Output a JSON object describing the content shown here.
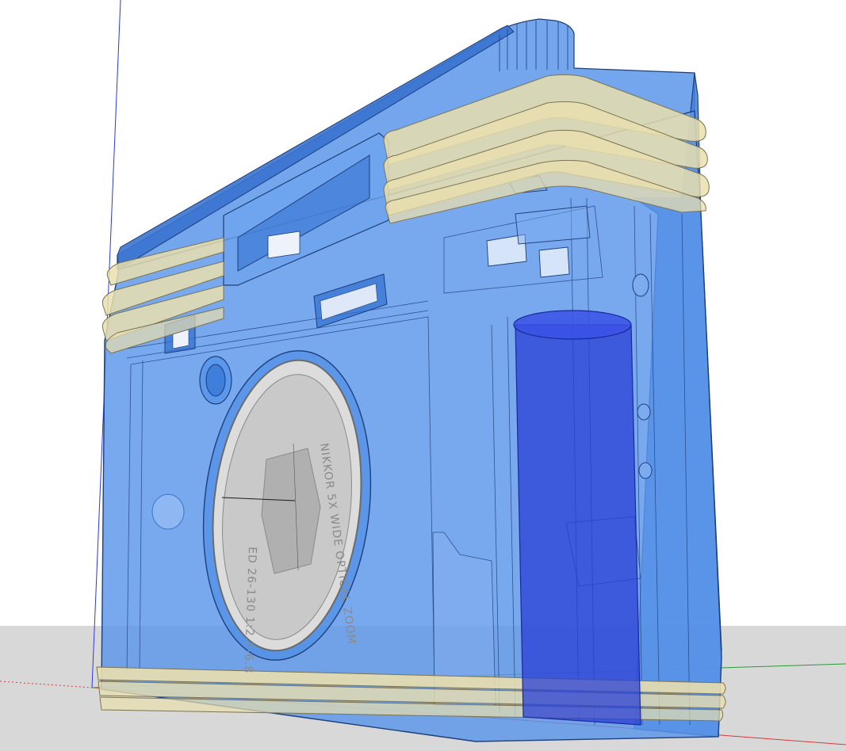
{
  "app": {
    "viewport_name": "3D model viewport",
    "background": {
      "sky": "#ffffff",
      "ground": "#d8d8d8"
    }
  },
  "axes": {
    "blue": "#2b3bd6",
    "red": "#d83a3a",
    "green": "#2c9a3a"
  },
  "model": {
    "body_color": "#4f8fe6",
    "body_dark": "#2f6fd0",
    "body_edge": "#1e3f7a",
    "trim_color": "#e9dfae",
    "trim_edge": "#7d7350",
    "lens_glass": "#c9c9c9",
    "battery_color": "#2a3fd6",
    "lens_text": {
      "ring_top": "NIKKOR 5X WIDE OPTICAL ZOOM",
      "ring_bottom": "ED 26-130 1:2.7-6.8"
    }
  }
}
